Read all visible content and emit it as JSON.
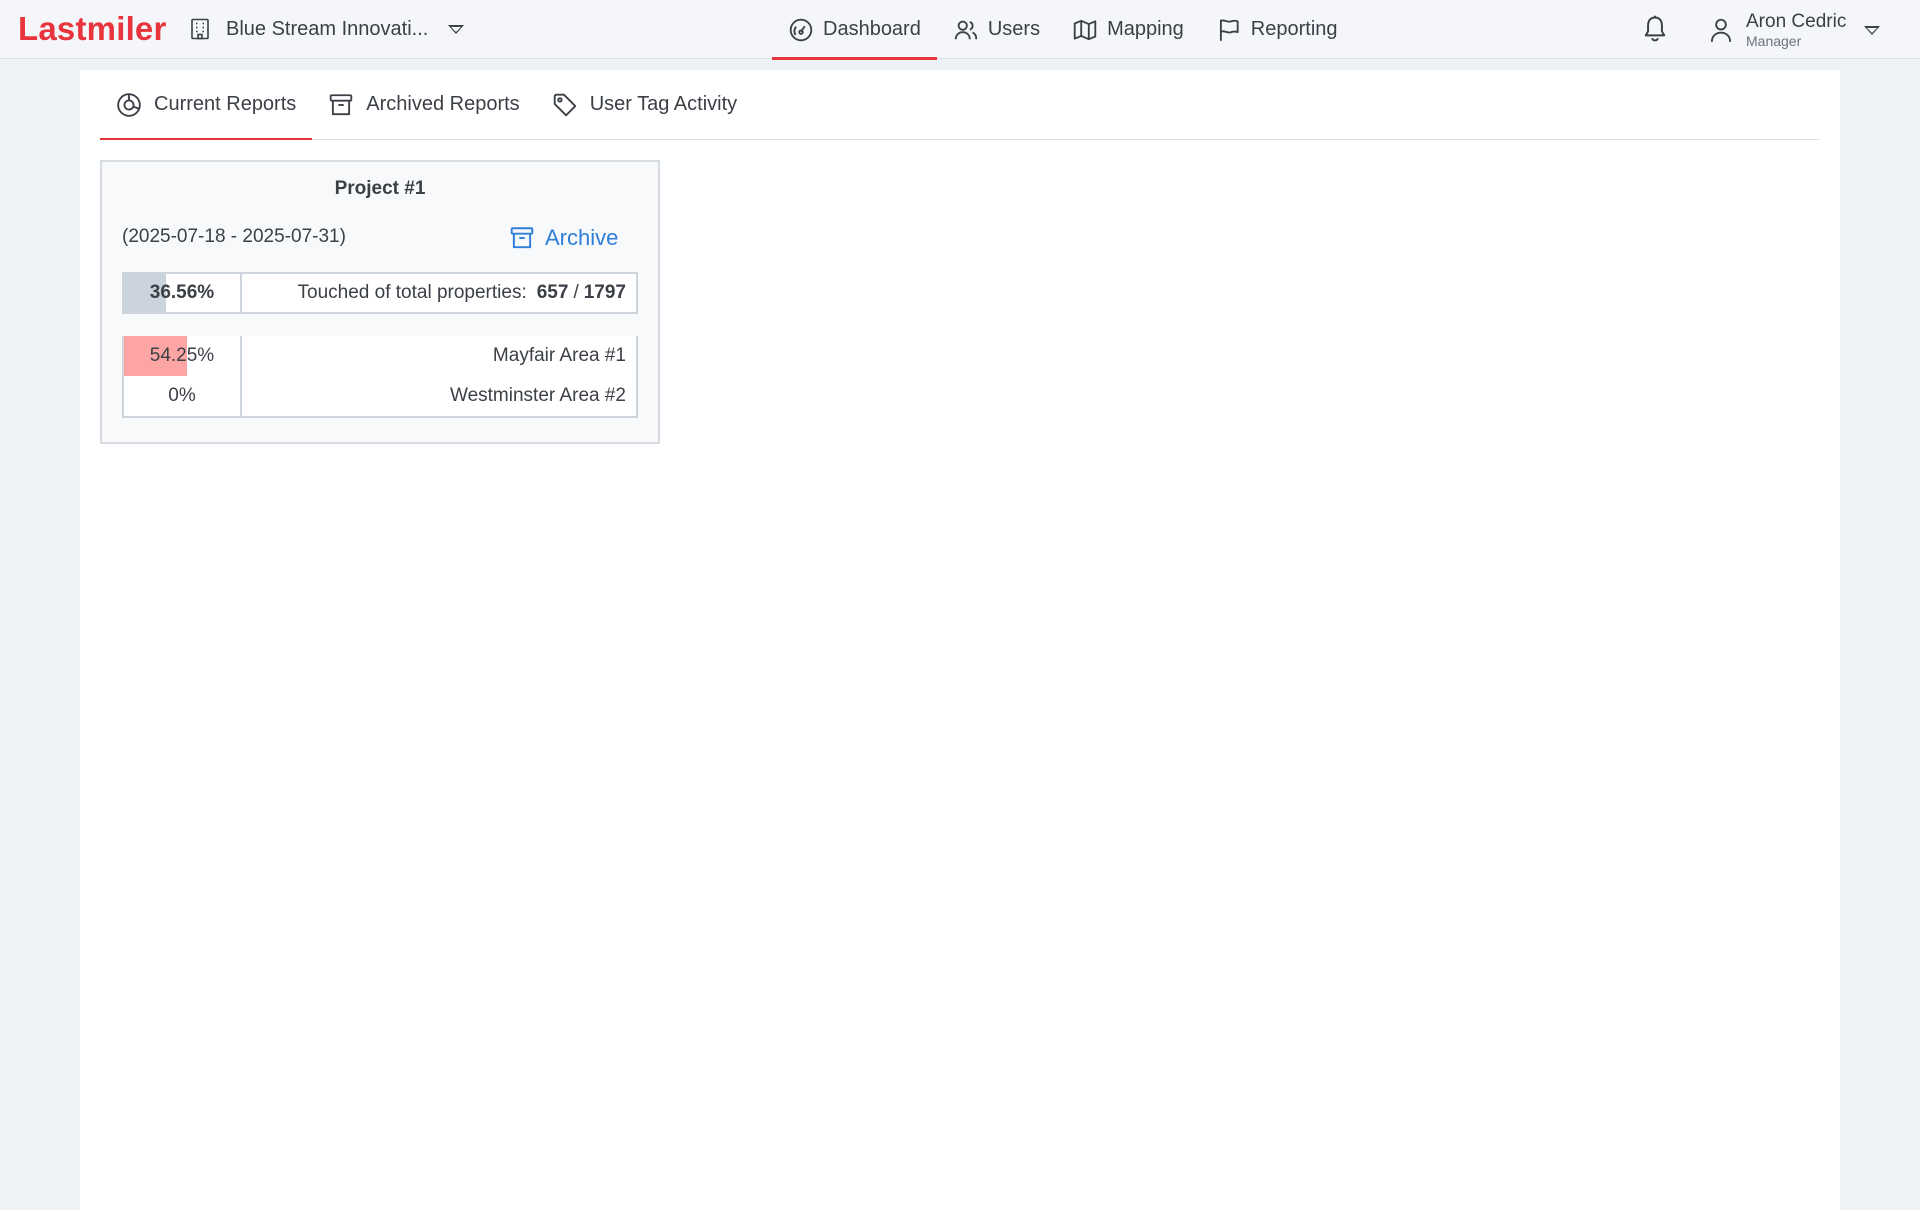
{
  "app": {
    "logo_text": "Lastmiler",
    "organization": "Blue Stream Innovati..."
  },
  "nav": {
    "items": [
      {
        "label": "Dashboard",
        "icon": "dashboard-gauge-icon",
        "active": true
      },
      {
        "label": "Users",
        "icon": "users-icon",
        "active": false
      },
      {
        "label": "Mapping",
        "icon": "map-icon",
        "active": false
      },
      {
        "label": "Reporting",
        "icon": "flag-icon",
        "active": false
      }
    ]
  },
  "user": {
    "name": "Aron Cedric",
    "role": "Manager"
  },
  "tabs": [
    {
      "label": "Current Reports",
      "icon": "pie-chart-icon",
      "active": true
    },
    {
      "label": "Archived Reports",
      "icon": "archive-box-icon",
      "active": false
    },
    {
      "label": "User Tag Activity",
      "icon": "tag-icon",
      "active": false
    }
  ],
  "report": {
    "title": "Project #1",
    "date_range": "(2025-07-18 - 2025-07-31)",
    "archive_label": "Archive",
    "total": {
      "percent_label": "36.56%",
      "percent_value": 36.56,
      "label": "Touched of total properties:",
      "touched": "657",
      "separator": "/",
      "total": "1797"
    },
    "areas": [
      {
        "percent_label": "54.25%",
        "percent_value": 54.25,
        "name": "Mayfair Area #1"
      },
      {
        "percent_label": "0%",
        "percent_value": 0,
        "name": "Westminster Area #2"
      }
    ]
  },
  "colors": {
    "brand_red": "#e8343c",
    "link_blue": "#2f7ed8",
    "total_fill": "#cbd3dd",
    "area_fill": "#fda4a4"
  }
}
